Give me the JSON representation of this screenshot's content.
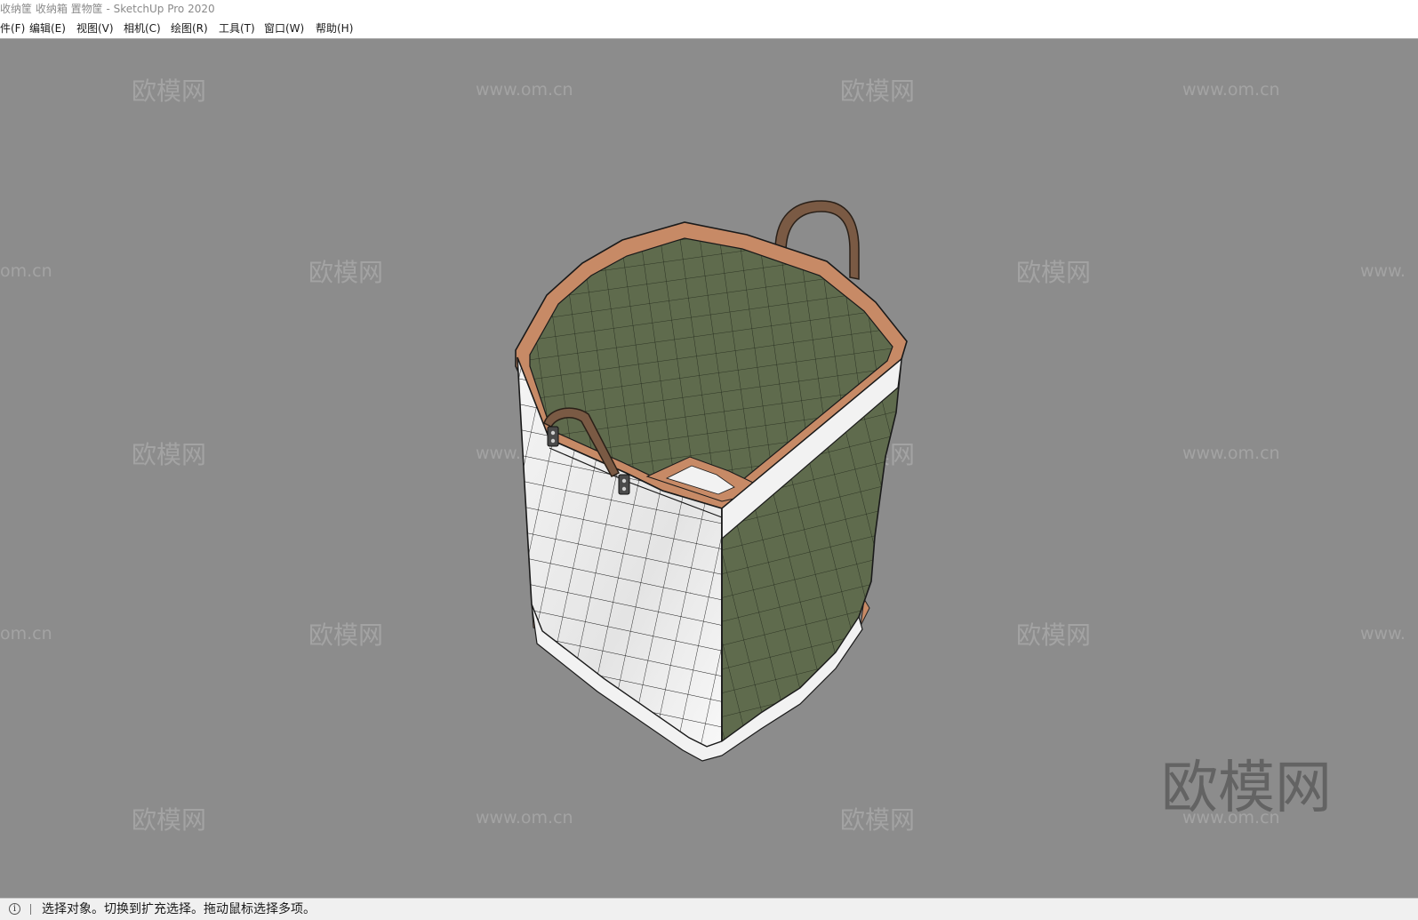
{
  "window": {
    "title": "收纳筐 收纳箱 置物筐 - SketchUp Pro 2020"
  },
  "menu": {
    "items": [
      {
        "label": "件(F)"
      },
      {
        "label": "编辑(E)"
      },
      {
        "label": "视图(V)"
      },
      {
        "label": "相机(C)"
      },
      {
        "label": "绘图(R)"
      },
      {
        "label": "工具(T)"
      },
      {
        "label": "窗口(W)"
      },
      {
        "label": "帮助(H)"
      }
    ]
  },
  "watermark": {
    "brand": "欧模网",
    "url": "www.om.cn",
    "url_partial_left": "om.cn",
    "url_partial_right": "www."
  },
  "status": {
    "info_icon": "info-circle-icon",
    "text": "选择对象。切换到扩充选择。拖动鼠标选择多项。"
  },
  "colors": {
    "viewport_bg": "#8c8c8c",
    "bag_exterior": "#f2f2f2",
    "bag_interior": "#5f6b4d",
    "bag_rim": "#c78a66",
    "handle": "#7a5a44"
  }
}
